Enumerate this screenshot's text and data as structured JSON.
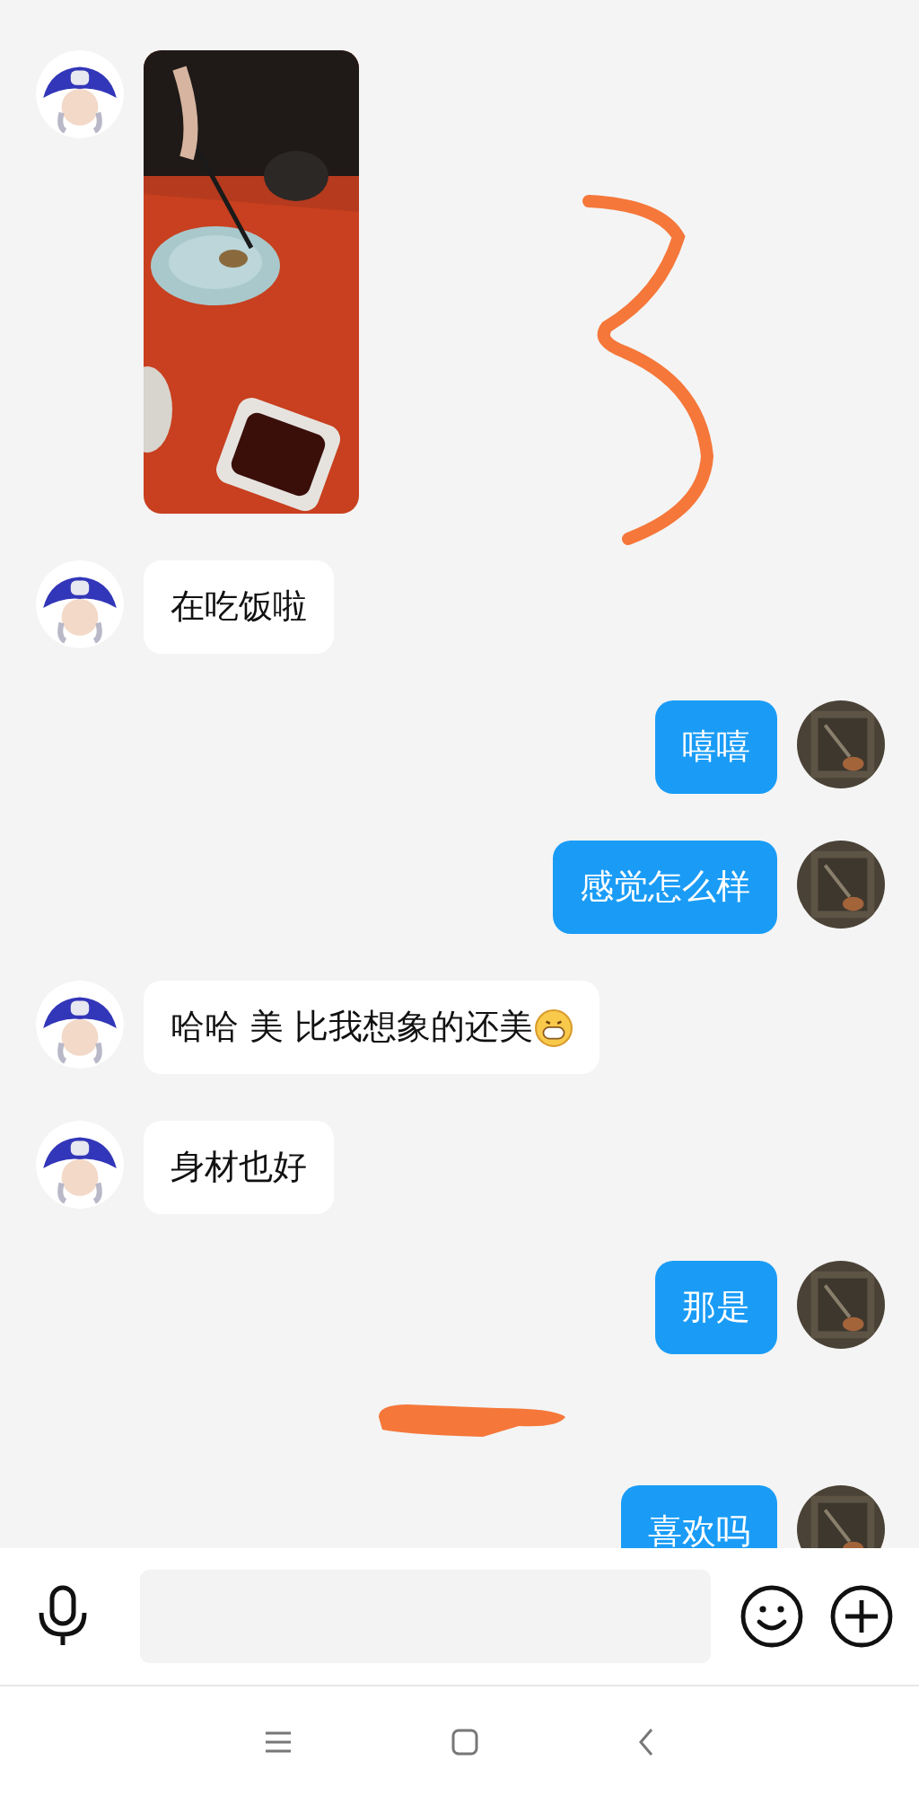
{
  "messages": [
    {
      "kind": "received_image"
    },
    {
      "kind": "received_text",
      "text": "在吃饭啦"
    },
    {
      "kind": "sent_text",
      "text": "嘻嘻"
    },
    {
      "kind": "sent_text",
      "text": "感觉怎么样"
    },
    {
      "kind": "received_text",
      "text": "哈哈 美 比我想象的还美",
      "trailing_emoji": true
    },
    {
      "kind": "received_text",
      "text": "身材也好"
    },
    {
      "kind": "sent_text",
      "text": "那是"
    },
    {
      "kind": "scribble"
    },
    {
      "kind": "sent_text",
      "text": "喜欢吗"
    }
  ]
}
